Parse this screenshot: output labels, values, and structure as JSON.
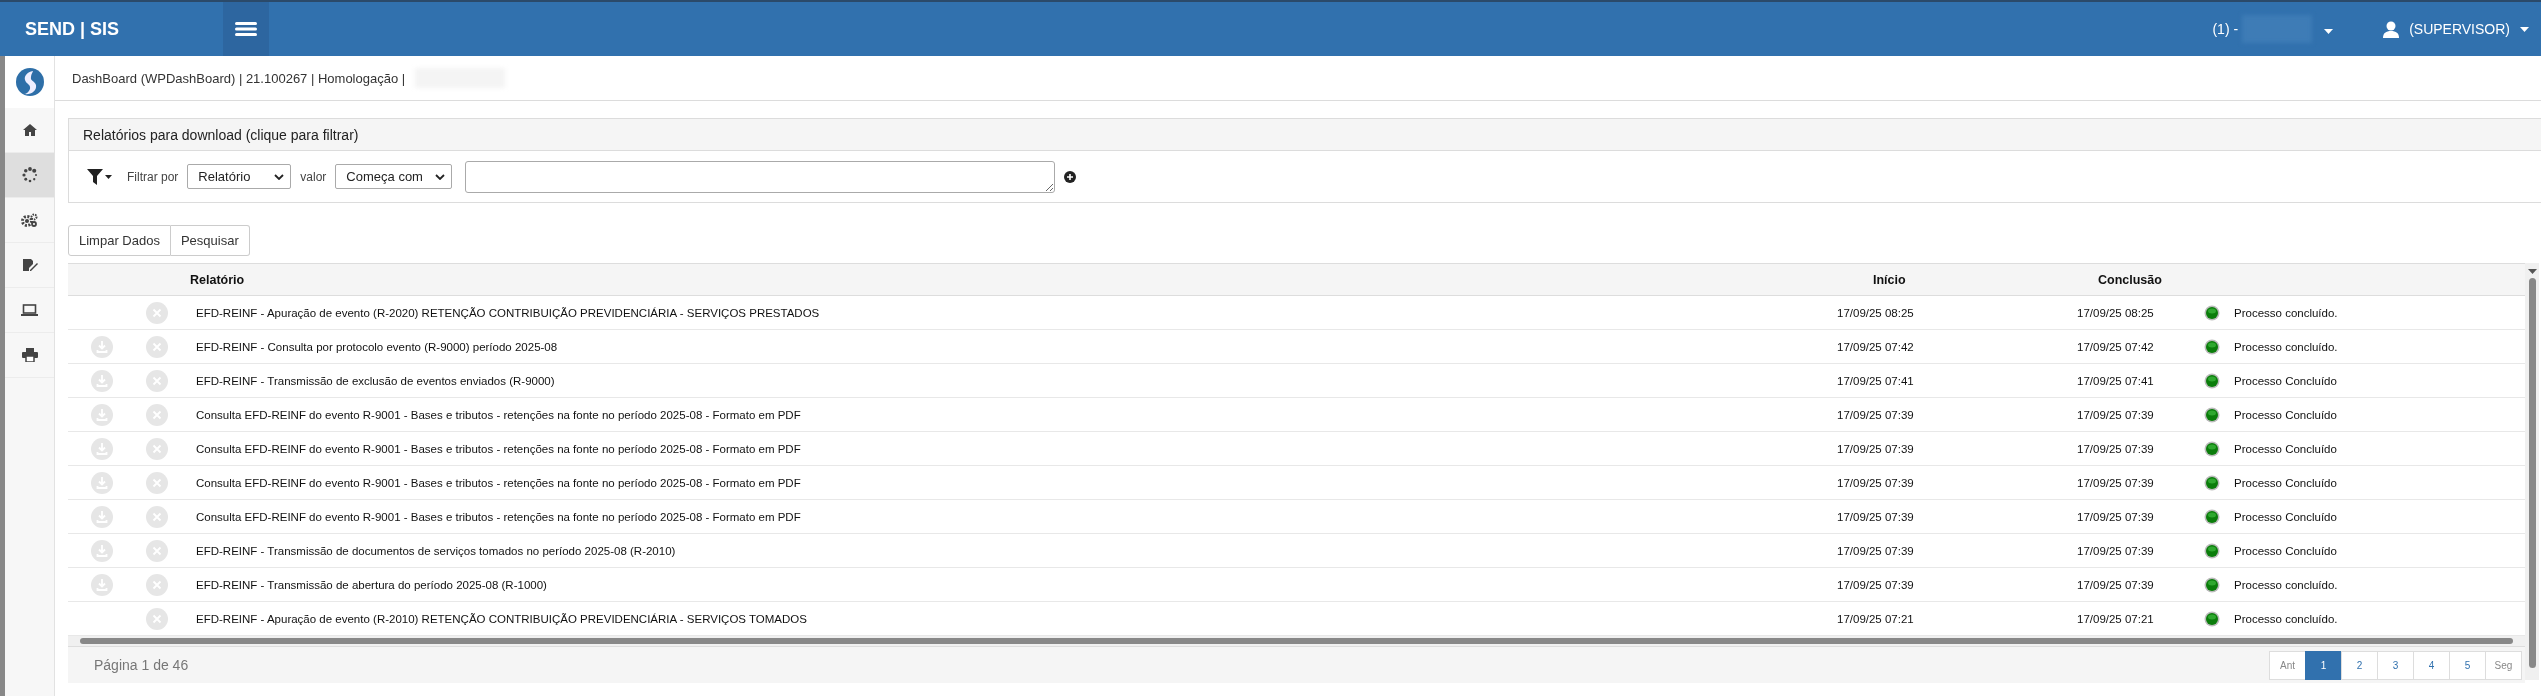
{
  "header": {
    "brand": "SEND | SIS",
    "company_prefix": "(1) -",
    "user": "(SUPERVISOR)"
  },
  "sidebar": {
    "items": [
      {
        "kind": "home",
        "selected": false
      },
      {
        "kind": "spinner",
        "selected": true
      },
      {
        "kind": "gears",
        "selected": false
      },
      {
        "kind": "edit",
        "selected": false
      },
      {
        "kind": "laptop",
        "selected": false
      },
      {
        "kind": "printer",
        "selected": false
      }
    ]
  },
  "breadcrumb": "DashBoard (WPDashBoard) | 21.100267 | Homologação |",
  "panel": {
    "title": "Relatórios para download (clique para filtrar)",
    "filter_label": "Filtrar por",
    "filter_field": "Relatório",
    "value_label": "valor",
    "operator": "Começa com"
  },
  "buttons": [
    "Limpar Dados",
    "Pesquisar"
  ],
  "table": {
    "columns": [
      "Relatório",
      "Início",
      "Conclusão"
    ],
    "rows": [
      {
        "downloadable": false,
        "report": "EFD-REINF - Apuração de evento (R-2020) RETENÇÃO CONTRIBUIÇÃO PREVIDENCIÁRIA - SERVIÇOS PRESTADOS",
        "start": "17/09/25 08:25",
        "end": "17/09/25 08:25",
        "status": "Processo concluído."
      },
      {
        "downloadable": true,
        "report": "EFD-REINF - Consulta por protocolo evento (R-9000) período 2025-08",
        "start": "17/09/25 07:42",
        "end": "17/09/25 07:42",
        "status": "Processo concluído."
      },
      {
        "downloadable": true,
        "report": "EFD-REINF - Transmissão de exclusão de eventos enviados (R-9000)",
        "start": "17/09/25 07:41",
        "end": "17/09/25 07:41",
        "status": "Processo Concluído"
      },
      {
        "downloadable": true,
        "report": "Consulta EFD-REINF do evento R-9001 - Bases e tributos - retenções na fonte no período 2025-08 - Formato em PDF",
        "start": "17/09/25 07:39",
        "end": "17/09/25 07:39",
        "status": "Processo Concluído"
      },
      {
        "downloadable": true,
        "report": "Consulta EFD-REINF do evento R-9001 - Bases e tributos - retenções na fonte no período 2025-08 - Formato em PDF",
        "start": "17/09/25 07:39",
        "end": "17/09/25 07:39",
        "status": "Processo Concluído"
      },
      {
        "downloadable": true,
        "report": "Consulta EFD-REINF do evento R-9001 - Bases e tributos - retenções na fonte no período 2025-08 - Formato em PDF",
        "start": "17/09/25 07:39",
        "end": "17/09/25 07:39",
        "status": "Processo Concluído"
      },
      {
        "downloadable": true,
        "report": "Consulta EFD-REINF do evento R-9001 - Bases e tributos - retenções na fonte no período 2025-08 - Formato em PDF",
        "start": "17/09/25 07:39",
        "end": "17/09/25 07:39",
        "status": "Processo Concluído"
      },
      {
        "downloadable": true,
        "report": "EFD-REINF - Transmissão de documentos de serviços tomados no período 2025-08 (R-2010)",
        "start": "17/09/25 07:39",
        "end": "17/09/25 07:39",
        "status": "Processo Concluído"
      },
      {
        "downloadable": true,
        "report": "EFD-REINF - Transmissão de abertura do período 2025-08 (R-1000)",
        "start": "17/09/25 07:39",
        "end": "17/09/25 07:39",
        "status": "Processo concluído."
      },
      {
        "downloadable": false,
        "report": "EFD-REINF - Apuração de evento (R-2010) RETENÇÃO CONTRIBUIÇÃO PREVIDENCIÁRIA - SERVIÇOS TOMADOS",
        "start": "17/09/25 07:21",
        "end": "17/09/25 07:21",
        "status": "Processo concluído."
      }
    ]
  },
  "footer": {
    "page_info": "Página 1 de 46",
    "pager": [
      {
        "label": "Ant",
        "selected": false
      },
      {
        "label": "1",
        "selected": true
      },
      {
        "label": "2",
        "selected": false
      },
      {
        "label": "3",
        "selected": false
      },
      {
        "label": "4",
        "selected": false
      },
      {
        "label": "5",
        "selected": false
      },
      {
        "label": "Seg",
        "selected": false
      }
    ]
  }
}
